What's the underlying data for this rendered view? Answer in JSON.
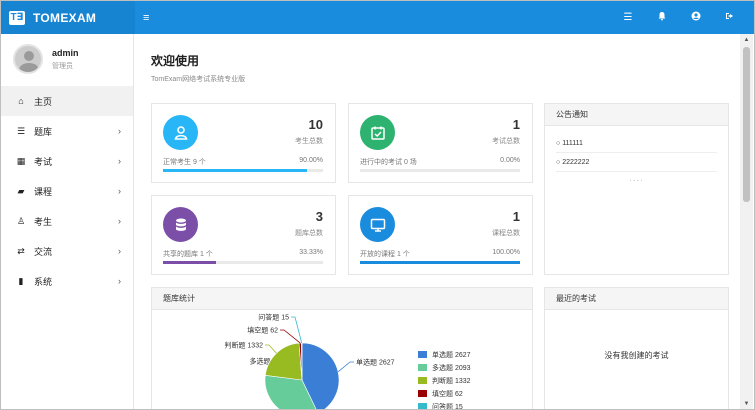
{
  "brand": {
    "logo": "T∃",
    "name": "TOMEXAM"
  },
  "topbar": {
    "menu_icon": "≡",
    "icons": [
      "list-icon",
      "bell-icon",
      "user-circle-icon",
      "signout-icon"
    ]
  },
  "user": {
    "name": "admin",
    "role": "管理员"
  },
  "nav": {
    "items": [
      {
        "icon": "home-icon",
        "glyph": "⌂",
        "label": "主页"
      },
      {
        "icon": "database-icon",
        "glyph": "☰",
        "label": "题库"
      },
      {
        "icon": "calendar-check-icon",
        "glyph": "▦",
        "label": "考试"
      },
      {
        "icon": "book-icon",
        "glyph": "▰",
        "label": "课程"
      },
      {
        "icon": "user-icon",
        "glyph": "♙",
        "label": "考生"
      },
      {
        "icon": "shuffle-icon",
        "glyph": "⇄",
        "label": "交流"
      },
      {
        "icon": "mobile-icon",
        "glyph": "▮",
        "label": "系统"
      }
    ]
  },
  "page": {
    "title": "欢迎使用",
    "subtitle": "TomExam网络考试系统专业版"
  },
  "stats": [
    {
      "icon": "user-icon",
      "color": "#29b6f6",
      "value": "10",
      "label": "考生总数",
      "foot": "正常考生 9 个",
      "pct": "90.00%",
      "fill": 0.9
    },
    {
      "icon": "calendar-check-icon",
      "color": "#2db36f",
      "value": "1",
      "label": "考试总数",
      "foot": "进行中的考试 0 场",
      "pct": "0.00%",
      "fill": 0.0
    },
    {
      "icon": "database-icon",
      "color": "#7b4fa8",
      "value": "3",
      "label": "题库总数",
      "foot": "共享的题库 1 个",
      "pct": "33.33%",
      "fill": 0.3333
    },
    {
      "icon": "monitor-icon",
      "color": "#1a8cde",
      "value": "1",
      "label": "课程总数",
      "foot": "开放的课程 1 个",
      "pct": "100.00%",
      "fill": 1.0
    }
  ],
  "notice": {
    "title": "公告通知",
    "items": [
      "111111",
      "2222222"
    ],
    "more": "····"
  },
  "bank_stats": {
    "title": "题库统计"
  },
  "recent": {
    "title": "最近的考试",
    "empty": "没有我创建的考试"
  },
  "chart_data": {
    "type": "pie",
    "title": "",
    "slices": [
      {
        "label": "单选题",
        "value": 2627,
        "color": "#3a7fd5"
      },
      {
        "label": "多选题",
        "value": 2093,
        "color": "#66cc99"
      },
      {
        "label": "判断题",
        "value": 1332,
        "color": "#99bb22"
      },
      {
        "label": "填空题",
        "value": 62,
        "color": "#990000"
      },
      {
        "label": "问答题",
        "value": 15,
        "color": "#33bbcc"
      }
    ],
    "legend_position": "right"
  }
}
